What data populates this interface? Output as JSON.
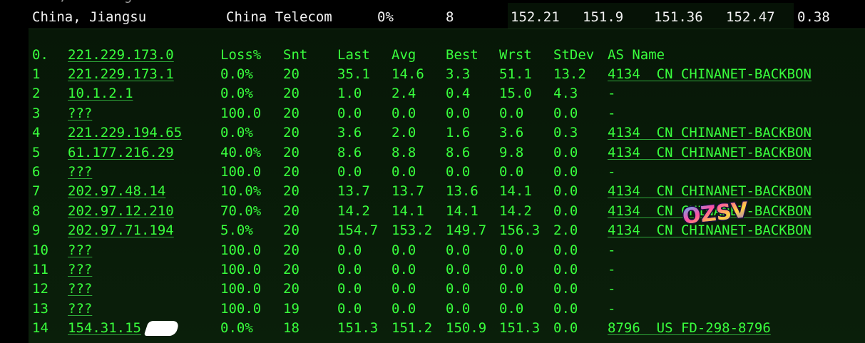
{
  "summary": {
    "location": "China, Jiangsu",
    "isp": "China Telecom",
    "loss": "0%",
    "sent": "8",
    "last": "152.21",
    "avg": "151.9",
    "best": "151.36",
    "worst": "152.47",
    "stdev": "0.38"
  },
  "trace": {
    "header": {
      "index": "0.",
      "host": "221.229.173.0",
      "loss": "Loss%",
      "snt": "Snt",
      "last": "Last",
      "avg": "Avg",
      "best": "Best",
      "wrst": "Wrst",
      "stdev": "StDev",
      "asname": "AS Name"
    },
    "hops": [
      {
        "n": "1",
        "host": "221.229.173.1",
        "loss": "0.0%",
        "snt": "20",
        "last": "35.1",
        "avg": "14.6",
        "best": "3.3",
        "wrst": "51.1",
        "stdev": "13.2",
        "as": "4134  CN CHINANET-BACKBON"
      },
      {
        "n": "2",
        "host": "10.1.2.1",
        "loss": "0.0%",
        "snt": "20",
        "last": "1.0",
        "avg": "2.4",
        "best": "0.4",
        "wrst": "15.0",
        "stdev": "4.3",
        "as": "-"
      },
      {
        "n": "3",
        "host": "???",
        "loss": "100.0",
        "snt": "20",
        "last": "0.0",
        "avg": "0.0",
        "best": "0.0",
        "wrst": "0.0",
        "stdev": "0.0",
        "as": "-"
      },
      {
        "n": "4",
        "host": "221.229.194.65",
        "loss": "0.0%",
        "snt": "20",
        "last": "3.6",
        "avg": "2.0",
        "best": "1.6",
        "wrst": "3.6",
        "stdev": "0.3",
        "as": "4134  CN CHINANET-BACKBON"
      },
      {
        "n": "5",
        "host": "61.177.216.29",
        "loss": "40.0%",
        "snt": "20",
        "last": "8.6",
        "avg": "8.8",
        "best": "8.6",
        "wrst": "9.8",
        "stdev": "0.0",
        "as": "4134  CN CHINANET-BACKBON"
      },
      {
        "n": "6",
        "host": "???",
        "loss": "100.0",
        "snt": "20",
        "last": "0.0",
        "avg": "0.0",
        "best": "0.0",
        "wrst": "0.0",
        "stdev": "0.0",
        "as": "-"
      },
      {
        "n": "7",
        "host": "202.97.48.14",
        "loss": "10.0%",
        "snt": "20",
        "last": "13.7",
        "avg": "13.7",
        "best": "13.6",
        "wrst": "14.1",
        "stdev": "0.0",
        "as": "4134  CN CHINANET-BACKBON"
      },
      {
        "n": "8",
        "host": "202.97.12.210",
        "loss": "70.0%",
        "snt": "20",
        "last": "14.2",
        "avg": "14.1",
        "best": "14.1",
        "wrst": "14.2",
        "stdev": "0.0",
        "as": "4134  CN CHINANET-BACKBON"
      },
      {
        "n": "9",
        "host": "202.97.71.194",
        "loss": "5.0%",
        "snt": "20",
        "last": "154.7",
        "avg": "153.2",
        "best": "149.7",
        "wrst": "156.3",
        "stdev": "2.0",
        "as": "4134  CN CHINANET-BACKBON"
      },
      {
        "n": "10",
        "host": "???",
        "loss": "100.0",
        "snt": "20",
        "last": "0.0",
        "avg": "0.0",
        "best": "0.0",
        "wrst": "0.0",
        "stdev": "0.0",
        "as": "-"
      },
      {
        "n": "11",
        "host": "???",
        "loss": "100.0",
        "snt": "20",
        "last": "0.0",
        "avg": "0.0",
        "best": "0.0",
        "wrst": "0.0",
        "stdev": "0.0",
        "as": "-"
      },
      {
        "n": "12",
        "host": "???",
        "loss": "100.0",
        "snt": "20",
        "last": "0.0",
        "avg": "0.0",
        "best": "0.0",
        "wrst": "0.0",
        "stdev": "0.0",
        "as": "-"
      },
      {
        "n": "13",
        "host": "???",
        "loss": "100.0",
        "snt": "19",
        "last": "0.0",
        "avg": "0.0",
        "best": "0.0",
        "wrst": "0.0",
        "stdev": "0.0",
        "as": "-"
      },
      {
        "n": "14",
        "host": "154.31.15",
        "loss": "0.0%",
        "snt": "18",
        "last": "151.3",
        "avg": "151.2",
        "best": "150.9",
        "wrst": "151.3",
        "stdev": "0.0",
        "as": "8796  US FD-298-8796"
      }
    ]
  },
  "watermark": {
    "text": "OZSV",
    "colors": [
      "#ff4fa3",
      "#ffd23f",
      "#3ec1ff",
      "#7b5cff"
    ]
  },
  "colors": {
    "terminal_green": "#39ff3d",
    "panel_bg": "#0a1f0a",
    "summary_text": "#f2f2f2"
  }
}
